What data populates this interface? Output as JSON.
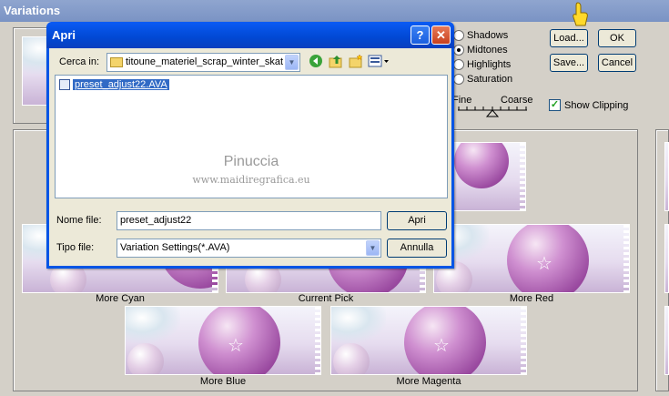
{
  "variations": {
    "title": "Variations",
    "radios": [
      {
        "label": "Shadows",
        "selected": false
      },
      {
        "label": "Midtones",
        "selected": true
      },
      {
        "label": "Highlights",
        "selected": false
      },
      {
        "label": "Saturation",
        "selected": false
      }
    ],
    "load_label": "Load...",
    "ok_label": "OK",
    "save_label": "Save...",
    "cancel_label": "Cancel",
    "fine_label": "Fine",
    "coarse_label": "Coarse",
    "show_clipping_label": "Show Clipping",
    "show_clipping_checked": true,
    "captions": {
      "more_cyan": "More Cyan",
      "current_pick": "Current Pick",
      "more_red": "More Red",
      "more_blue": "More Blue",
      "more_magenta": "More Magenta"
    }
  },
  "dialog": {
    "title": "Apri",
    "help_label": "?",
    "close_label": "✕",
    "look_in_label": "Cerca in:",
    "look_in_value": "titoune_materiel_scrap_winter_skat",
    "file": "preset_adjust22.AVA",
    "watermark_name": "Pinuccia",
    "watermark_site": "www.maidiregrafica.eu",
    "filename_label": "Nome file:",
    "filename_value": "preset_adjust22",
    "filetype_label": "Tipo file:",
    "filetype_value": "Variation Settings(*.AVA)",
    "open_label": "Apri",
    "cancel_label": "Annulla"
  }
}
